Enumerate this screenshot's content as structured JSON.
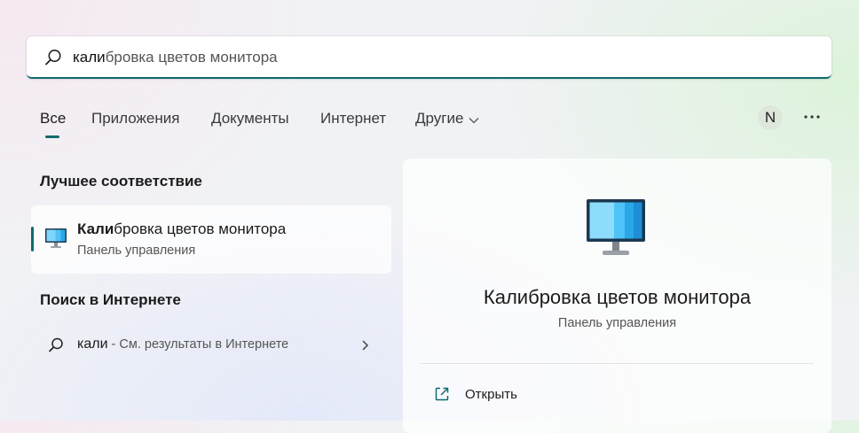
{
  "search": {
    "typed": "кали",
    "completion": "бровка цветов монитора"
  },
  "tabs": [
    {
      "label": "Все"
    },
    {
      "label": "Приложения"
    },
    {
      "label": "Документы"
    },
    {
      "label": "Интернет"
    },
    {
      "label": "Другие"
    }
  ],
  "user": {
    "initial": "N"
  },
  "best_match": {
    "section_title": "Лучшее соответствие",
    "title_typed": "Кали",
    "title_rest": "бровка цветов монитора",
    "subtitle": "Панель управления",
    "icon": "monitor-icon"
  },
  "web": {
    "section_title": "Поиск в Интернете",
    "query": "кали",
    "hint": " - См. результаты в Интернете"
  },
  "detail": {
    "title": "Калибровка цветов монитора",
    "subtitle": "Панель управления",
    "actions": [
      {
        "label": "Открыть",
        "icon": "open-external-icon"
      }
    ]
  },
  "colors": {
    "accent": "#0f6b6e"
  }
}
